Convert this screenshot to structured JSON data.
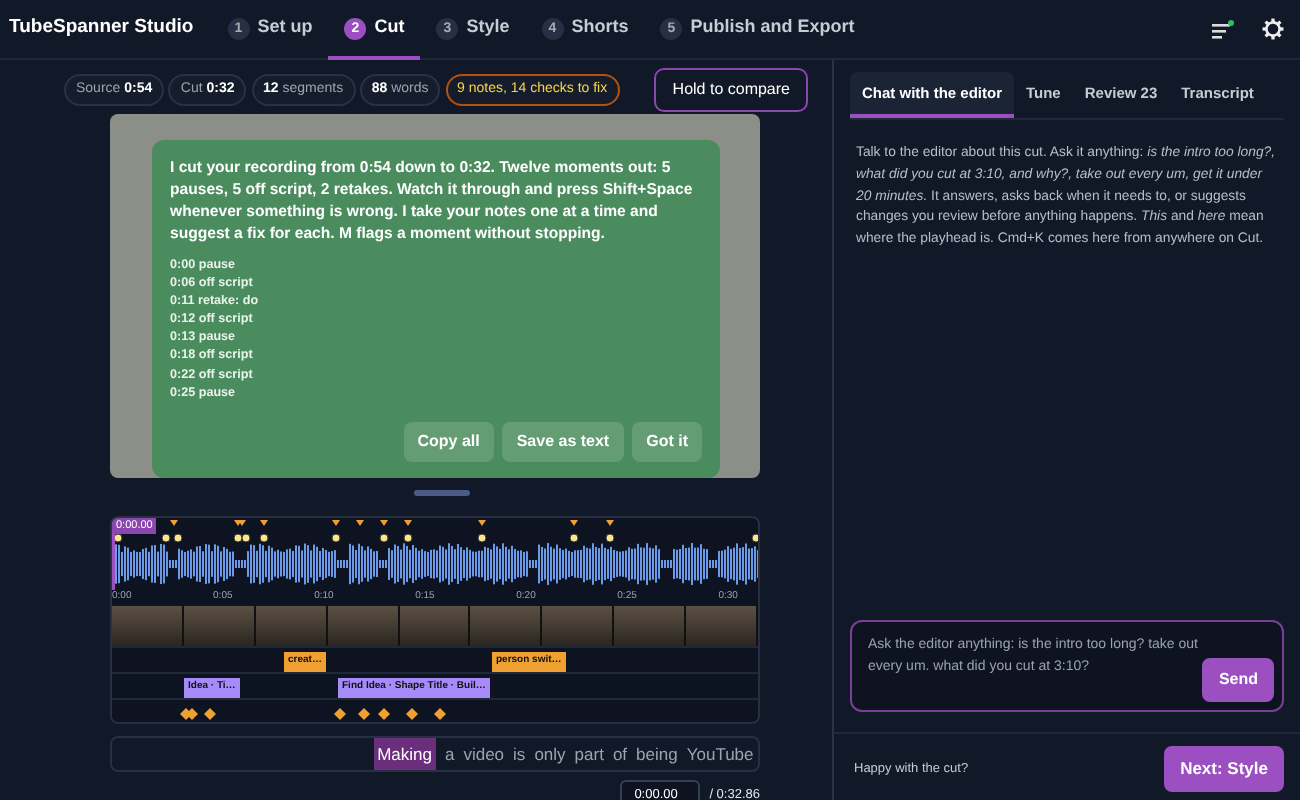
{
  "app": {
    "title": "TubeSpanner Studio"
  },
  "steps": [
    {
      "number": "1",
      "label": "Set up",
      "selected": false
    },
    {
      "number": "2",
      "label": "Cut",
      "selected": true
    },
    {
      "number": "3",
      "label": "Style",
      "selected": false
    },
    {
      "number": "4",
      "label": "Shorts",
      "selected": false
    },
    {
      "number": "5",
      "label": "Publish and Export",
      "selected": false
    }
  ],
  "stats": [
    {
      "kind": "stat",
      "label": "Source",
      "value": "0:54"
    },
    {
      "kind": "stat",
      "label": "Cut",
      "value": "0:32"
    },
    {
      "kind": "count",
      "value": "12",
      "label": "segments"
    },
    {
      "kind": "count",
      "value": "88",
      "label": "words"
    },
    {
      "kind": "warning",
      "label": "9 notes, 14 checks to fix"
    }
  ],
  "compare_button": "Hold to compare",
  "overlay": {
    "message": "I cut your recording from 0:54 down to 0:32. Twelve moments out: 5 pauses, 5 off script, 2 retakes. Watch it through and press Shift+Space whenever something is wrong. I take your notes one at a time and suggest a fix for each. M flags a moment without stopping.",
    "notes": [
      "0:00 pause",
      "0:06 off script",
      "0:11 retake: do",
      "0:12 off script",
      "0:13 pause",
      "0:18 off script",
      "0:22 off script",
      "0:25 pause"
    ],
    "buttons": [
      "Copy all",
      "Save as text",
      "Got it"
    ]
  },
  "timeline": {
    "playhead": "0:00.00",
    "ticks": [
      "0:00",
      "0:05",
      "0:10",
      "0:15",
      "0:20",
      "0:25",
      "0:30"
    ],
    "tracks": [
      {
        "kind": "broll",
        "clips": [
          "creat…",
          "person swit…"
        ]
      },
      {
        "kind": "title",
        "clips": [
          "Idea · Ti…",
          "Find Idea · Shape Title · Buil…"
        ]
      }
    ]
  },
  "transcript": [
    {
      "word": "Making",
      "selected": true
    },
    {
      "word": "a",
      "selected": false
    },
    {
      "word": "video",
      "selected": false
    },
    {
      "word": "is",
      "selected": false
    },
    {
      "word": "only",
      "selected": false
    },
    {
      "word": "part",
      "selected": false
    },
    {
      "word": "of",
      "selected": false
    },
    {
      "word": "being",
      "selected": false
    },
    {
      "word": "YouTube",
      "selected": false
    }
  ],
  "player": {
    "time": "0:00.00",
    "duration": "/ 0:32.86"
  },
  "panel_tabs": [
    {
      "label": "Chat with the editor",
      "selected": true
    },
    {
      "label": "Tune",
      "selected": false
    },
    {
      "label": "Review 23",
      "selected": false
    },
    {
      "label": "Transcript",
      "selected": false
    }
  ],
  "chat_intro": "Talk to the editor about this cut. Ask it anything: *is the intro too long?, what did you cut at 3:10, and why?, take out every um, get it under 20 minutes.* It answers, asks back when it needs to, or suggests changes you review before anything happens. *This* and *here* mean where the playhead is. Cmd+K comes here from anywhere on Cut.",
  "chat_input": {
    "placeholder": "Ask the editor anything: is the intro too long? take out every um. what did you cut at 3:10?",
    "button": "Send"
  },
  "footer": {
    "prompt": "Happy with the cut?",
    "button": "Next: Style"
  }
}
